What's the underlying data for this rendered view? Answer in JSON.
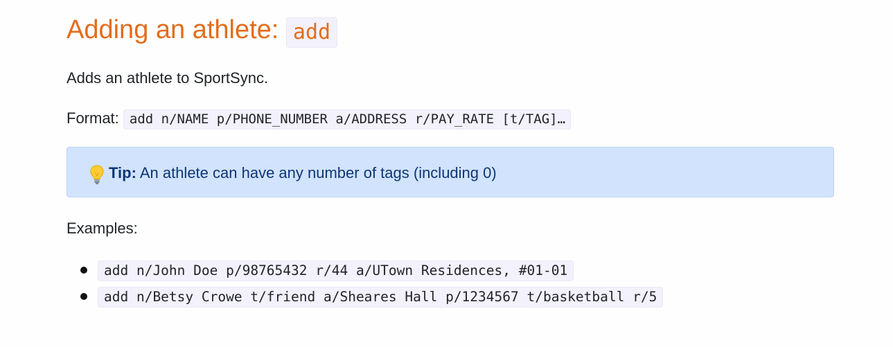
{
  "section": {
    "title_text": "Adding an athlete:",
    "title_command": "add"
  },
  "intro": "Adds an athlete to SportSync.",
  "format": {
    "label": "Format:",
    "command": "add n/NAME p/PHONE_NUMBER a/ADDRESS r/PAY_RATE [t/TAG]…"
  },
  "tip": {
    "icon": "lightbulb-icon",
    "label": "Tip:",
    "text": "An athlete can have any number of tags (including 0)"
  },
  "examples": {
    "label": "Examples:",
    "items": [
      "add n/John Doe p/98765432 r/44 a/UTown Residences, #01-01",
      "add n/Betsy Crowe t/friend a/Sheares Hall p/1234567 t/basketball r/5"
    ]
  },
  "colors": {
    "heading": "#e46c1c",
    "tip_background": "#d1e3fd",
    "tip_text": "#0e3675",
    "code_background": "#f3f1fb"
  }
}
